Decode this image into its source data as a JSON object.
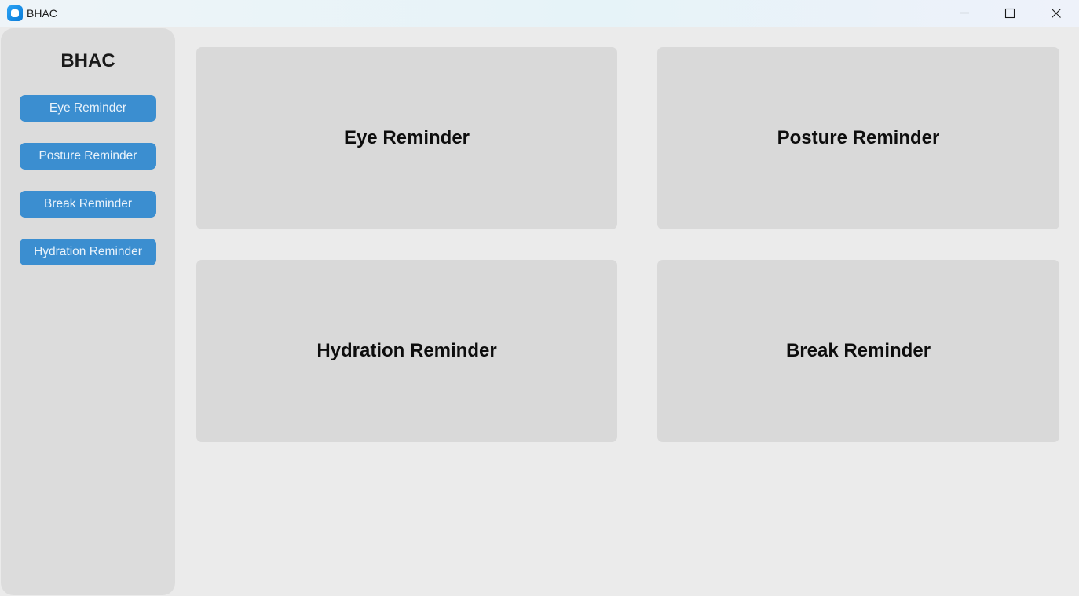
{
  "window": {
    "title": "BHAC",
    "icon": "app-icon",
    "controls": [
      "minimize-icon",
      "maximize-icon",
      "close-icon"
    ]
  },
  "sidebar": {
    "title": "BHAC",
    "items": [
      {
        "label": "Eye Reminder"
      },
      {
        "label": "Posture Reminder"
      },
      {
        "label": "Break Reminder"
      },
      {
        "label": "Hydration Reminder"
      }
    ]
  },
  "cards": {
    "eye": "Eye Reminder",
    "posture": "Posture Reminder",
    "hydration": "Hydration Reminder",
    "break": "Break Reminder"
  },
  "colors": {
    "accent": "#3b8ed0",
    "sidebar_bg": "#dcdcdc",
    "card_bg": "#d9d9d9",
    "main_bg": "#ebebeb"
  }
}
